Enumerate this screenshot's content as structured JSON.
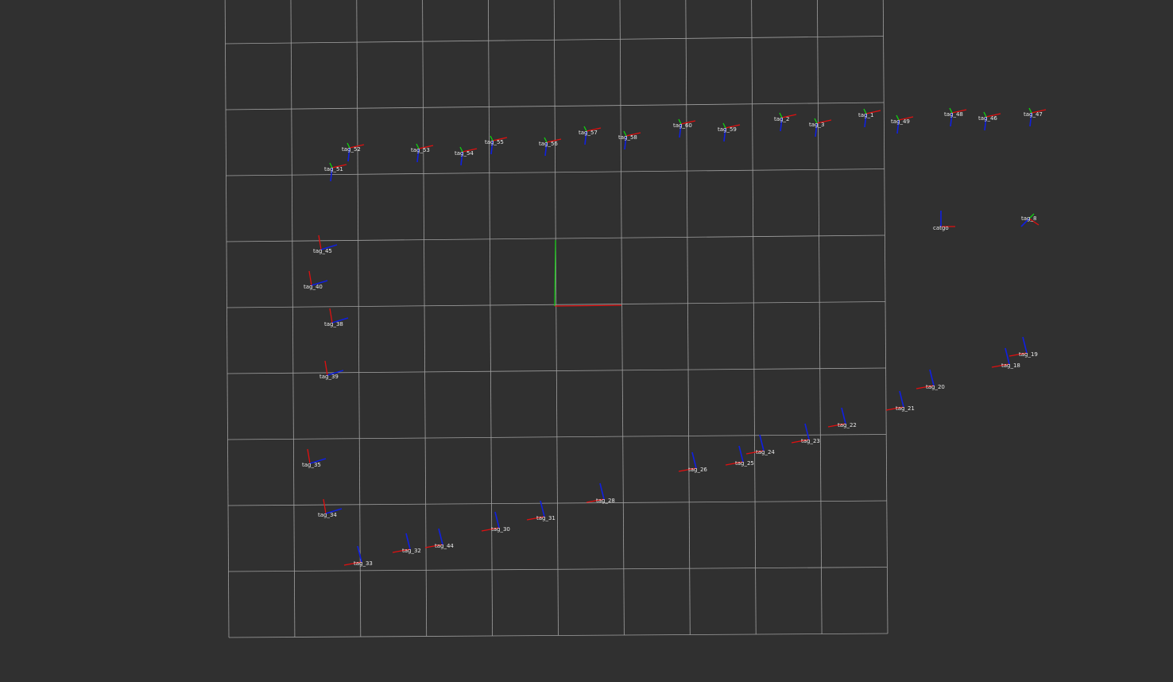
{
  "colors": {
    "background": "#303030",
    "grid": "#a0a0a0",
    "x_axis": "#e01010",
    "y_axis": "#10d010",
    "z_axis": "#1020e0",
    "label": "#e8e8e8"
  },
  "frames": [
    {
      "label": "tag_52"
    },
    {
      "label": "tag_51"
    },
    {
      "label": "tag_53"
    },
    {
      "label": "tag_54"
    },
    {
      "label": "tag_55"
    },
    {
      "label": "tag_56"
    },
    {
      "label": "tag_57"
    },
    {
      "label": "tag_58"
    },
    {
      "label": "tag_60"
    },
    {
      "label": "tag_59"
    },
    {
      "label": "tag_2"
    },
    {
      "label": "tag_3"
    },
    {
      "label": "tag_1"
    },
    {
      "label": "tag_49"
    },
    {
      "label": "tag_48"
    },
    {
      "label": "tag_46"
    },
    {
      "label": "tag_47"
    },
    {
      "label": "tag_45"
    },
    {
      "label": "tag_40"
    },
    {
      "label": "tag_38"
    },
    {
      "label": "tag_39"
    },
    {
      "label": "catgo"
    },
    {
      "label": "tag_8"
    },
    {
      "label": "tag_19"
    },
    {
      "label": "tag_18"
    },
    {
      "label": "tag_20"
    },
    {
      "label": "tag_21"
    },
    {
      "label": "tag_22"
    },
    {
      "label": "tag_23"
    },
    {
      "label": "tag_24"
    },
    {
      "label": "tag_25"
    },
    {
      "label": "tag_26"
    },
    {
      "label": "tag_28"
    },
    {
      "label": "tag_31"
    },
    {
      "label": "tag_30"
    },
    {
      "label": "tag_44"
    },
    {
      "label": "tag_32"
    },
    {
      "label": "tag_33"
    },
    {
      "label": "tag_34"
    },
    {
      "label": "tag_35"
    }
  ]
}
